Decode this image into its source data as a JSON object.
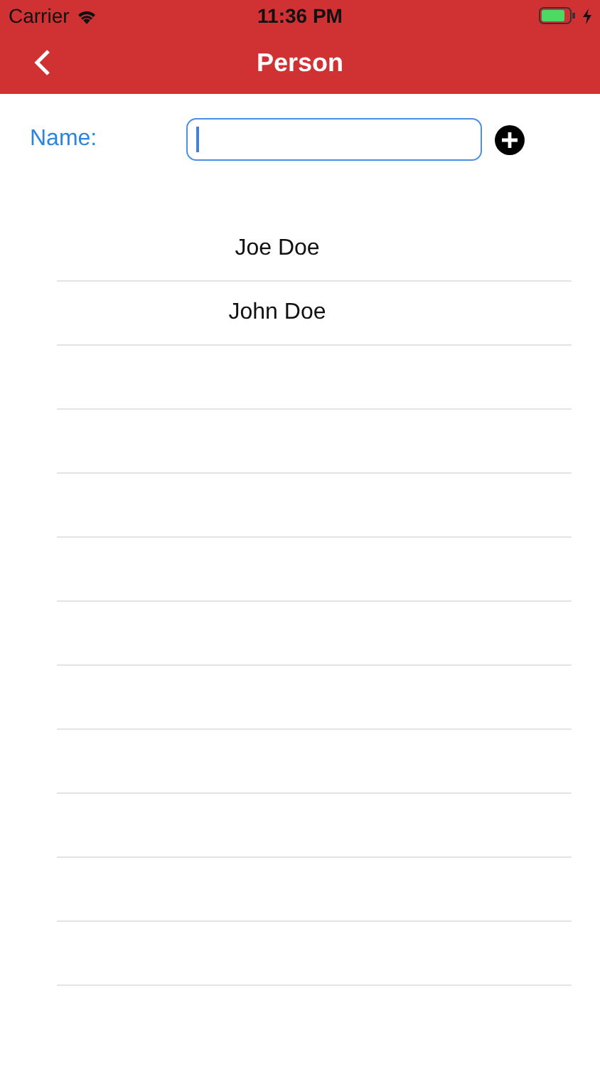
{
  "status_bar": {
    "carrier": "Carrier",
    "time": "11:36 PM"
  },
  "nav_bar": {
    "title": "Person"
  },
  "form": {
    "label": "Name:",
    "field": {
      "focused": true
    }
  },
  "people": [
    {
      "name": "Joe Doe"
    },
    {
      "name": "John Doe"
    }
  ]
}
